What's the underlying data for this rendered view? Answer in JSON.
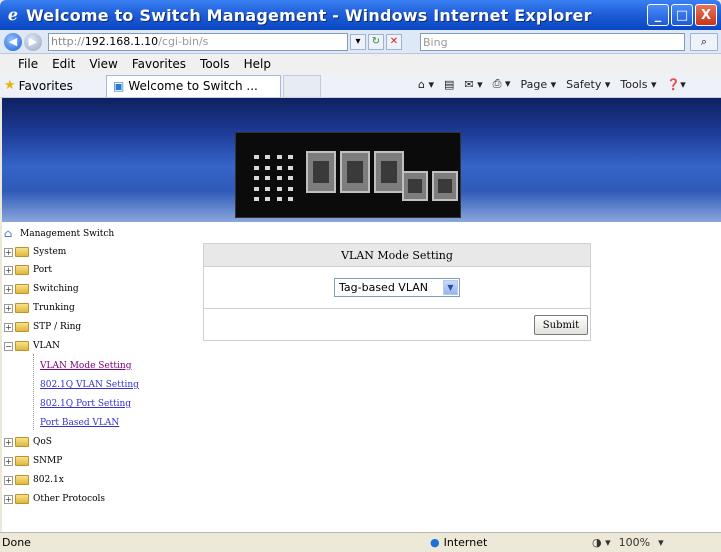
{
  "window": {
    "title": "Welcome to Switch Management - Windows Internet Explorer",
    "buttons": {
      "minimize": "_",
      "maximize": "□",
      "close": "X"
    }
  },
  "address_bar": {
    "protocol": "http://",
    "host": "192.168.1.10",
    "path": "/cgi-bin/s",
    "search_placeholder": "Bing"
  },
  "menu": [
    "File",
    "Edit",
    "View",
    "Favorites",
    "Tools",
    "Help"
  ],
  "favorites_bar": {
    "favorites_label": "Favorites",
    "tab_title": "Welcome to Switch ...",
    "tools": [
      "Page ▾",
      "Safety ▾",
      "Tools ▾"
    ]
  },
  "sidebar": {
    "root": "Management Switch",
    "items": [
      {
        "label": "System",
        "expanded": false
      },
      {
        "label": "Port",
        "expanded": false
      },
      {
        "label": "Switching",
        "expanded": false
      },
      {
        "label": "Trunking",
        "expanded": false
      },
      {
        "label": "STP / Ring",
        "expanded": false
      },
      {
        "label": "VLAN",
        "expanded": true
      },
      {
        "label": "QoS",
        "expanded": false
      },
      {
        "label": "SNMP",
        "expanded": false
      },
      {
        "label": "802.1x",
        "expanded": false
      },
      {
        "label": "Other Protocols",
        "expanded": false
      }
    ],
    "vlan_children": [
      "VLAN Mode Setting",
      "802.1Q VLAN Setting",
      "802.1Q Port Setting",
      "Port Based VLAN"
    ]
  },
  "panel": {
    "title": "VLAN Mode Setting",
    "mode_value": "Tag-based VLAN",
    "submit_label": "Submit"
  },
  "status_bar": {
    "text": "Done",
    "zone": "Internet",
    "zoom": "100%"
  }
}
